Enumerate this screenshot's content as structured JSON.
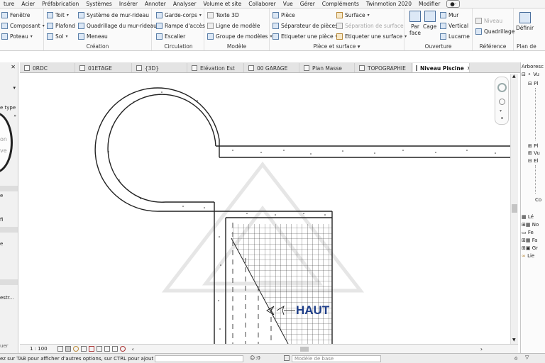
{
  "menu": [
    "ture",
    "Acier",
    "Préfabrication",
    "Systèmes",
    "Insérer",
    "Annoter",
    "Analyser",
    "Volume et site",
    "Collaborer",
    "Vue",
    "Gérer",
    "Compléments",
    "Twinmotion 2020",
    "Modifier"
  ],
  "ribbon": {
    "construction": {
      "items": [
        "Fenêtre",
        "Composant",
        "Poteau"
      ]
    },
    "creation": {
      "title": "Création",
      "items": [
        "Toit",
        "Plafond",
        "Sol",
        "Système de mur-rideau",
        "Quadrillage du mur-rideau",
        "Meneau"
      ]
    },
    "circulation": {
      "title": "Circulation",
      "items": [
        "Garde-corps",
        "Rampe d'accès",
        "Escalier"
      ]
    },
    "modele": {
      "title": "Modèle",
      "items": [
        "Texte 3D",
        "Ligne de modèle",
        "Groupe de modèles"
      ]
    },
    "piece": {
      "title": "Pièce et surface",
      "items": [
        "Pièce",
        "Séparateur de pièces",
        "Etiqueter une pièce",
        "Surface",
        "Séparation de surface",
        "Etiqueter une surface"
      ]
    },
    "ouverture": {
      "title": "Ouverture",
      "par_face": "Par face",
      "cage": "Cage",
      "items": [
        "Mur",
        "Vertical",
        "Lucarne"
      ]
    },
    "reference": {
      "title": "Référence",
      "items": [
        "Niveau",
        "Quadrillage"
      ]
    },
    "plan": {
      "title": "Plan de",
      "definir": "Définir"
    }
  },
  "tabs": [
    "0RDC",
    "01ETAGE",
    "{3D}",
    "Elévation Est",
    "00 GARAGE",
    "Plan Masse",
    "TOPOGRAPHIE",
    "Niveau Piscine"
  ],
  "left_panel": {
    "type_label": "e type",
    "field1": "on",
    "field2": "ve",
    "labels": [
      "e",
      "fi",
      "e",
      "estr..."
    ],
    "bottom": "uer"
  },
  "canvas": {
    "haut_label": "HAUT"
  },
  "view_bar": {
    "scale": "1 : 100"
  },
  "right_panel": {
    "title": "Arboresc",
    "items": [
      "Vu",
      "Pl",
      "Pl",
      "Vu",
      "El",
      "Co",
      "Lé",
      "No",
      "Fe",
      "Fa",
      "Gr",
      "Lie"
    ]
  },
  "status": {
    "hint": "ez sur TAB pour afficher d'autres options, sur CTRL pour ajout",
    "count": ":0",
    "model_field": "Modèle de base"
  },
  "colors": {
    "accent": "#1c6fb6",
    "haut": "#1f3f8a"
  }
}
